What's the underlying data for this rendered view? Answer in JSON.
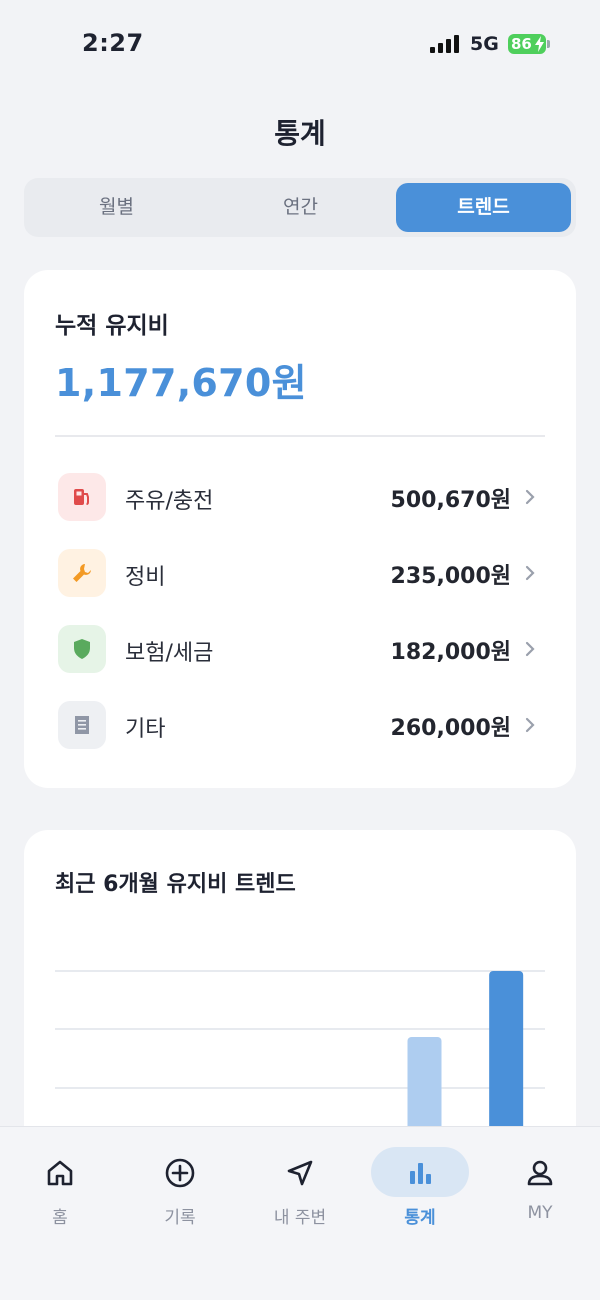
{
  "status": {
    "time": "2:27",
    "network": "5G",
    "battery": "86"
  },
  "header": {
    "title": "통계"
  },
  "segments": [
    {
      "label": "월별",
      "active": false
    },
    {
      "label": "연간",
      "active": false
    },
    {
      "label": "트렌드",
      "active": true
    }
  ],
  "summary": {
    "label": "누적 유지비",
    "total": "1,177,670원",
    "categories": [
      {
        "name": "주유/충전",
        "amount": "500,670원",
        "icon": "fuel-pump-icon",
        "color": "#e04b4b",
        "bg": "#fde8e8"
      },
      {
        "name": "정비",
        "amount": "235,000원",
        "icon": "wrench-icon",
        "color": "#f39a24",
        "bg": "#fff2e2"
      },
      {
        "name": "보험/세금",
        "amount": "182,000원",
        "icon": "shield-icon",
        "color": "#5aaa5e",
        "bg": "#e6f4e7"
      },
      {
        "name": "기타",
        "amount": "260,000원",
        "icon": "receipt-icon",
        "color": "#9097a6",
        "bg": "#eef0f3"
      }
    ]
  },
  "trend": {
    "title": "최근 6개월 유지비 트렌드"
  },
  "chart_data": {
    "type": "bar",
    "title": "최근 6개월 유지비 트렌드",
    "categories": [
      "",
      "",
      "",
      "",
      "",
      ""
    ],
    "values": [
      0,
      0,
      0,
      0,
      1.55,
      2.65
    ],
    "highlight_index": 5,
    "colors": {
      "default": "#aecdf0",
      "highlight": "#4a90d9"
    },
    "ylim": [
      0,
      2.65
    ],
    "grid": true,
    "note": "bars cropped at bottom of visible area; only two upper bars visible"
  },
  "tabbar": {
    "items": [
      {
        "label": "홈",
        "icon": "home-icon",
        "active": false
      },
      {
        "label": "기록",
        "icon": "plus-circle-icon",
        "active": false
      },
      {
        "label": "내 주변",
        "icon": "navigation-icon",
        "active": false
      },
      {
        "label": "통계",
        "icon": "bar-chart-icon",
        "active": true
      },
      {
        "label": "MY",
        "icon": "user-icon",
        "active": false
      }
    ]
  }
}
